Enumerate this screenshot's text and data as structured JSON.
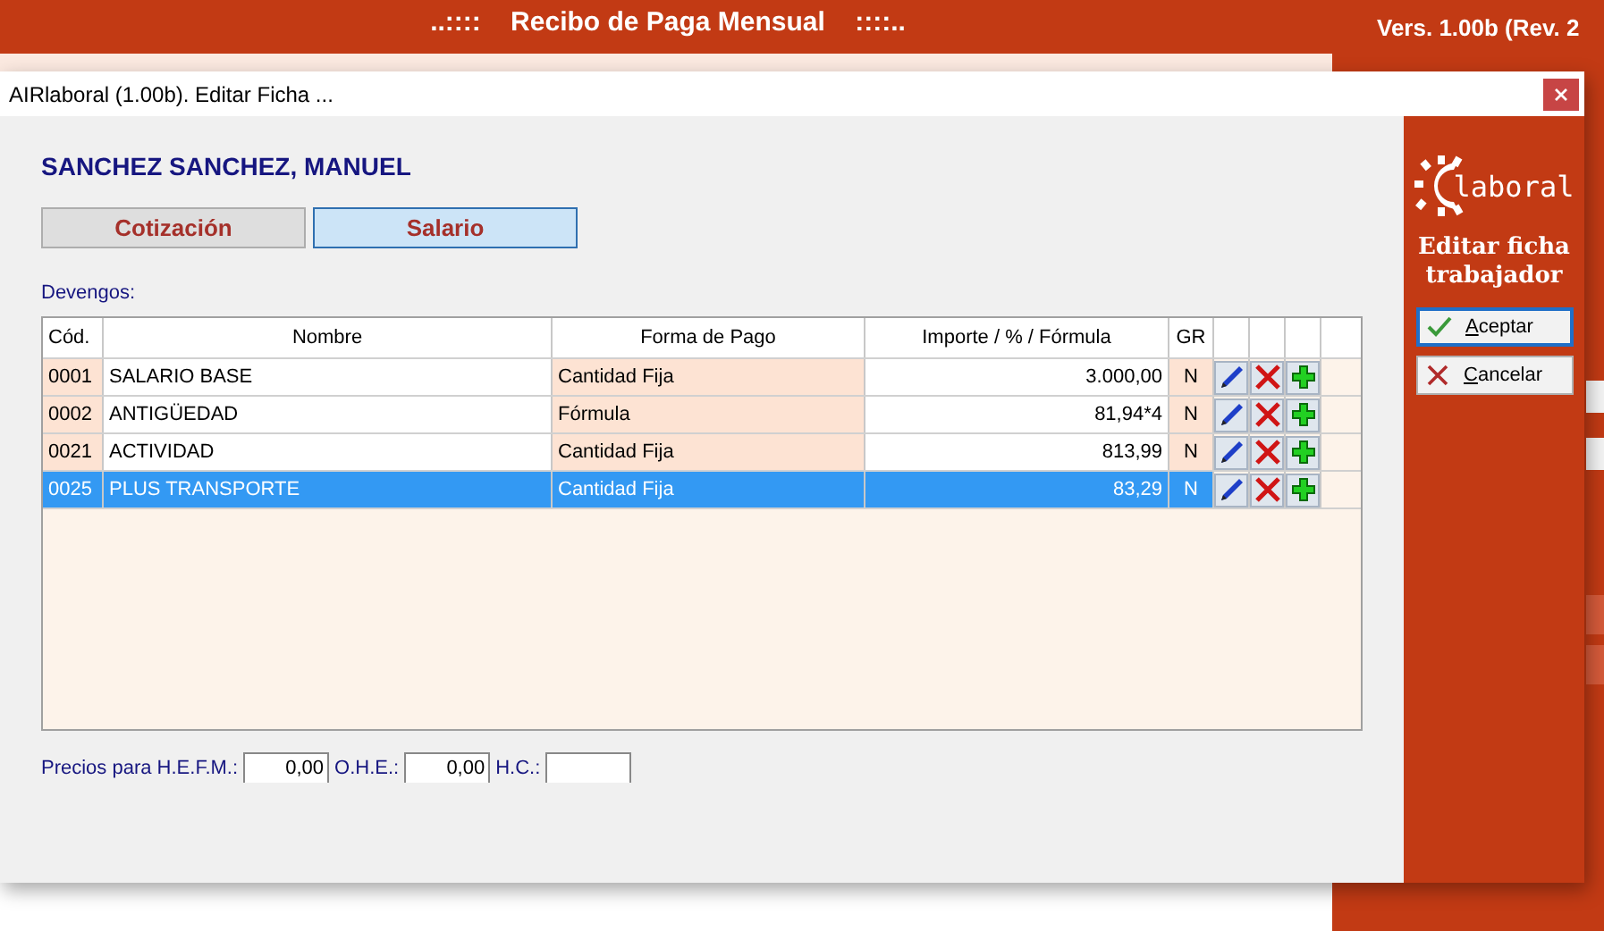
{
  "background_app": {
    "header": {
      "left_marks": "..::::",
      "title": "Recibo de Paga Mensual",
      "right_marks": "::::.."
    },
    "version": "Vers. 1.00b (Rev. 2"
  },
  "dialog": {
    "title": "AIRlaboral (1.00b). Editar Ficha ...",
    "employee_name": "SANCHEZ SANCHEZ, MANUEL",
    "tabs": [
      {
        "label": "Cotización",
        "selected": false
      },
      {
        "label": "Salario",
        "selected": true
      }
    ],
    "devengos": {
      "label": "Devengos:",
      "columns": [
        "Cód.",
        "Nombre",
        "Forma de Pago",
        "Importe  /  %  /  Fórmula",
        "GR"
      ],
      "rows": [
        {
          "cod": "0001",
          "nombre": "SALARIO BASE",
          "forma": "Cantidad Fija",
          "importe": "3.000,00",
          "gr": "N",
          "selected": false
        },
        {
          "cod": "0002",
          "nombre": "ANTIGÜEDAD",
          "forma": "Fórmula",
          "importe": "81,94*4",
          "gr": "N",
          "selected": false
        },
        {
          "cod": "0021",
          "nombre": "ACTIVIDAD",
          "forma": "Cantidad Fija",
          "importe": "813,99",
          "gr": "N",
          "selected": false
        },
        {
          "cod": "0025",
          "nombre": "PLUS TRANSPORTE",
          "forma": "Cantidad Fija",
          "importe": "83,29",
          "gr": "N",
          "selected": true
        }
      ]
    },
    "prices": {
      "label": "Precios para H.E.F.M.:",
      "hefm_value": "0,00",
      "ohe_label": "O.H.E.:",
      "ohe_value": "0,00",
      "hc_label": "H.C.:"
    },
    "side_panel": {
      "logo_text": "laboral",
      "heading": "Editar ficha trabajador",
      "buttons": [
        {
          "label": "Aceptar",
          "kind": "accept",
          "focused": true
        },
        {
          "label": "Cancelar",
          "kind": "cancel",
          "focused": false
        }
      ]
    }
  }
}
